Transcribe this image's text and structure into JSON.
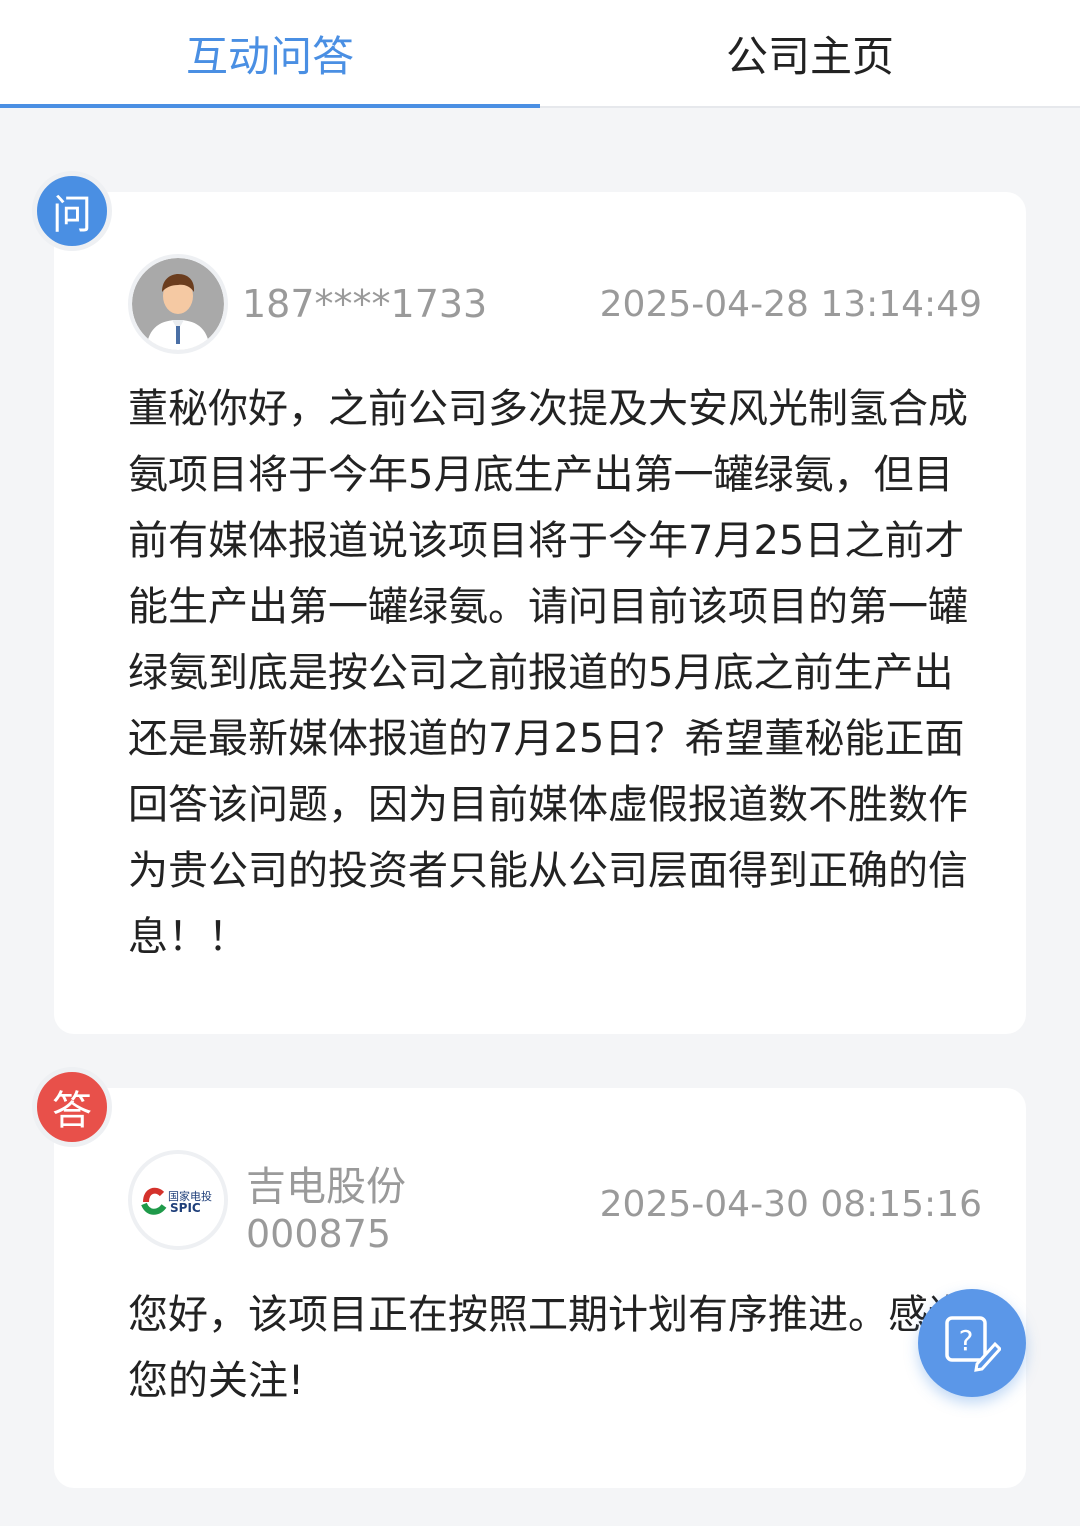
{
  "tabs": [
    {
      "label": "互动问答",
      "active": true
    },
    {
      "label": "公司主页",
      "active": false
    }
  ],
  "question": {
    "badge": "问",
    "user": "187****1733",
    "time": "2025-04-28 13:14:49",
    "text": "董秘你好，之前公司多次提及大安风光制氢合成氨项目将于今年5月底生产出第一罐绿氨，但目前有媒体报道说该项目将于今年7月25日之前才能生产出第一罐绿氨。请问目前该项目的第一罐绿氨到底是按公司之前报道的5月底之前生产出还是最新媒体报道的7月25日？希望董秘能正面回答该问题，因为目前媒体虚假报道数不胜数作为贵公司的投资者只能从公司层面得到正确的信息！！"
  },
  "answer": {
    "badge": "答",
    "company_name": "吉电股份",
    "company_code": "000875",
    "logo_text": {
      "cn": "国家电投",
      "en": "SPIC"
    },
    "time": "2025-04-30 08:15:16",
    "text": "您好，该项目正在按照工期计划有序推进。感谢您的关注!"
  },
  "fab_icon": "ask-question-icon",
  "colors": {
    "accent": "#4a8fe3",
    "answer_badge": "#e8504a",
    "muted": "#9a9a9a"
  }
}
